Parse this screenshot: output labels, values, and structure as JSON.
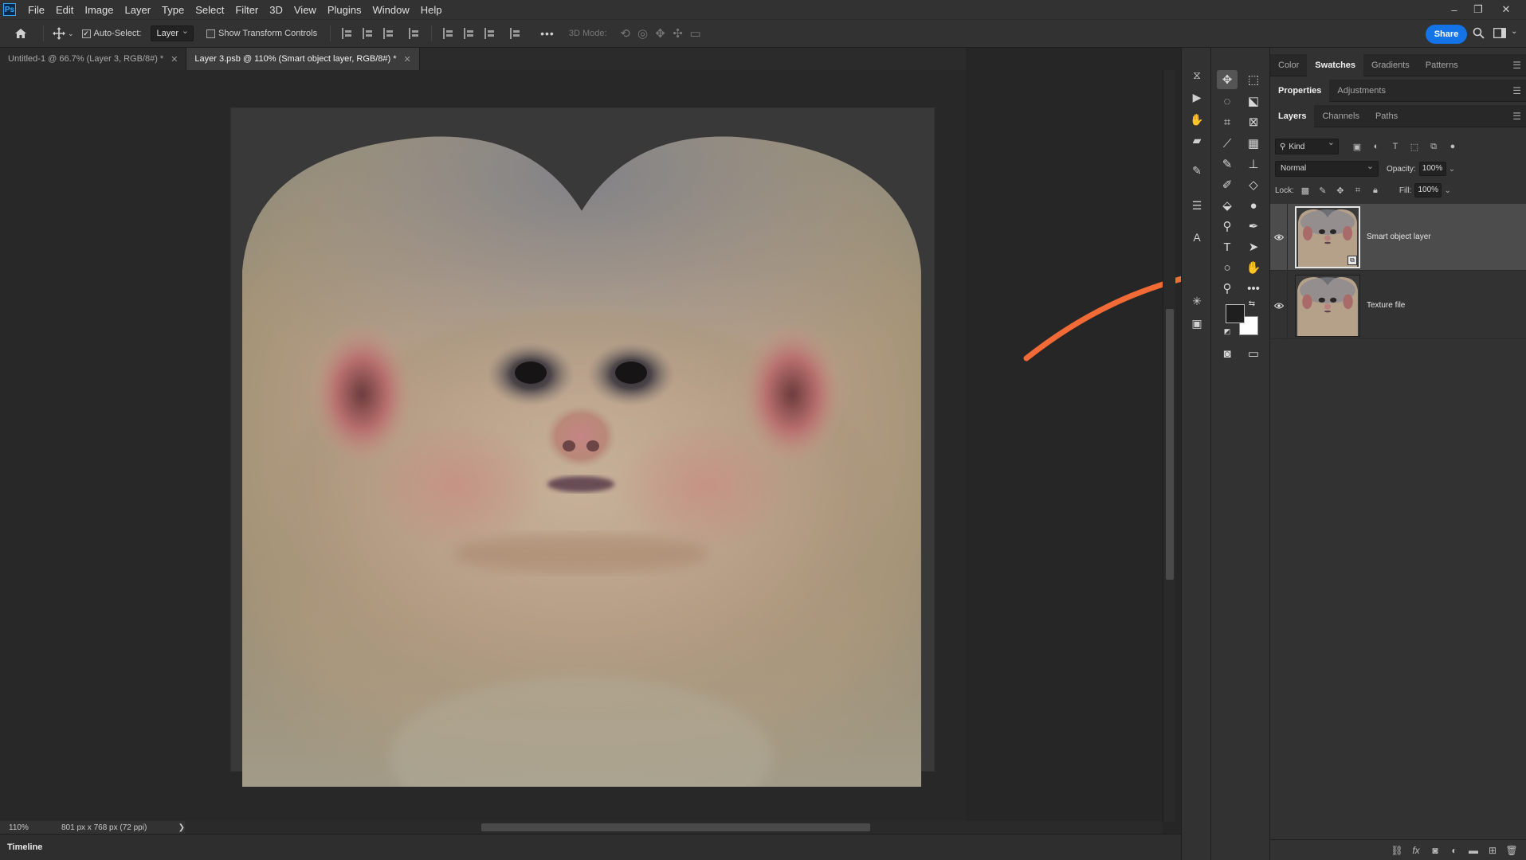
{
  "app": {
    "logo": "Ps",
    "window_controls": [
      "–",
      "❐",
      "✕"
    ]
  },
  "menu": [
    "File",
    "Edit",
    "Image",
    "Layer",
    "Type",
    "Select",
    "Filter",
    "3D",
    "View",
    "Plugins",
    "Window",
    "Help"
  ],
  "options_bar": {
    "auto_select_label": "Auto-Select:",
    "auto_select_checked": true,
    "auto_select_target": "Layer",
    "show_transform_label": "Show Transform Controls",
    "show_transform_checked": false,
    "more": "•••",
    "three_d_mode_label": "3D Mode:",
    "share_label": "Share"
  },
  "tabs": [
    {
      "label": "Untitled-1 @ 66.7% (Layer 3, RGB/8#) *",
      "active": false
    },
    {
      "label": "Layer 3.psb @ 110% (Smart object layer, RGB/8#) *",
      "active": true
    }
  ],
  "status": {
    "zoom": "110%",
    "doc_info": "801 px x 768 px (72 ppi)",
    "arrow": "❯"
  },
  "timeline_label": "Timeline",
  "panels": {
    "group1_tabs": [
      {
        "label": "Color",
        "active": false
      },
      {
        "label": "Swatches",
        "active": true
      },
      {
        "label": "Gradients",
        "active": false
      },
      {
        "label": "Patterns",
        "active": false
      }
    ],
    "group2_tabs": [
      {
        "label": "Properties",
        "active": true
      },
      {
        "label": "Adjustments",
        "active": false
      }
    ],
    "group3_tabs": [
      {
        "label": "Layers",
        "active": true
      },
      {
        "label": "Channels",
        "active": false
      },
      {
        "label": "Paths",
        "active": false
      }
    ],
    "filter_kind": "Kind",
    "blend_mode": "Normal",
    "opacity_label": "Opacity:",
    "opacity_value": "100%",
    "lock_label": "Lock:",
    "fill_label": "Fill:",
    "fill_value": "100%"
  },
  "layers": [
    {
      "name": "Smart object layer",
      "visible": true,
      "selected": true,
      "smart_object": true
    },
    {
      "name": "Texture file",
      "visible": true,
      "selected": false,
      "smart_object": false
    }
  ],
  "annotation": {
    "color": "#f26a35",
    "icon": "arrow-annotation"
  },
  "colors": {
    "foreground": "#1f1f1f",
    "background": "#ffffff",
    "accent": "#1473e6"
  }
}
